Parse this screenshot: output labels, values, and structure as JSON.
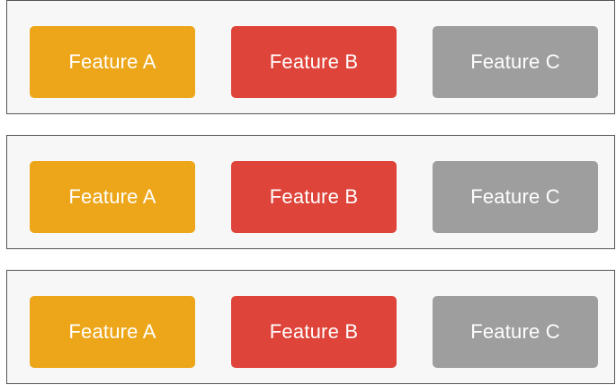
{
  "colors": {
    "feature_a": "#EDA619",
    "feature_b": "#DF443A",
    "feature_c": "#9D9E9D",
    "panel_border": "#555555",
    "panel_background": "#F7F7F7"
  },
  "rows": [
    {
      "buttons": [
        {
          "label": "Feature A"
        },
        {
          "label": "Feature B"
        },
        {
          "label": "Feature C"
        }
      ]
    },
    {
      "buttons": [
        {
          "label": "Feature A"
        },
        {
          "label": "Feature B"
        },
        {
          "label": "Feature C"
        }
      ]
    },
    {
      "buttons": [
        {
          "label": "Feature A"
        },
        {
          "label": "Feature B"
        },
        {
          "label": "Feature C"
        }
      ]
    }
  ]
}
